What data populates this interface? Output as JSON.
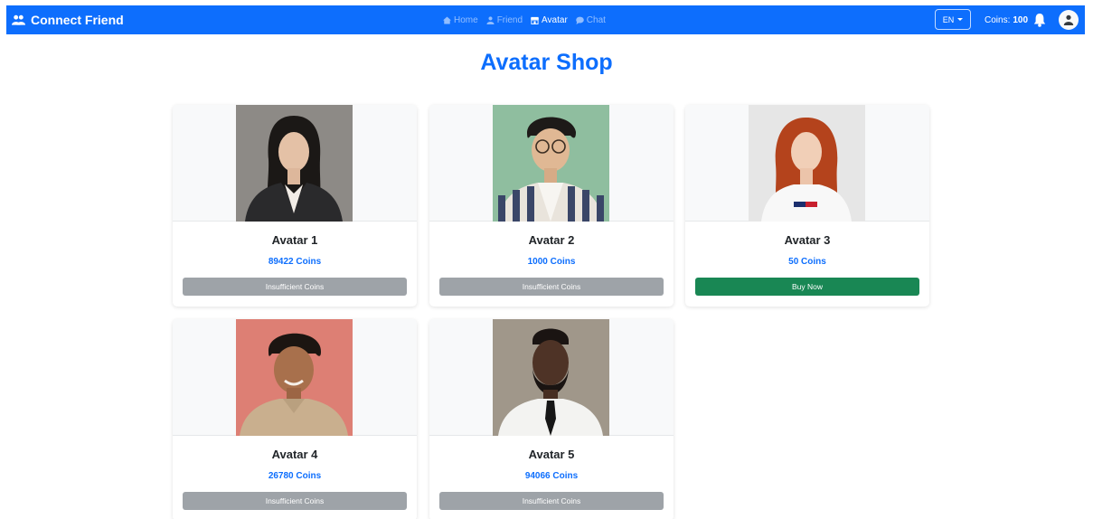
{
  "brand": {
    "name": "Connect Friend",
    "icon": "users-icon"
  },
  "nav": {
    "links": [
      {
        "label": "Home",
        "icon": "house-icon",
        "active": false
      },
      {
        "label": "Friend",
        "icon": "person-icon",
        "active": false
      },
      {
        "label": "Avatar",
        "icon": "shop-icon",
        "active": true
      },
      {
        "label": "Chat",
        "icon": "chat-icon",
        "active": false
      }
    ],
    "language": "EN",
    "coins_label": "Coins:",
    "coins_value": "100"
  },
  "page": {
    "title": "Avatar Shop"
  },
  "avatars": [
    {
      "name": "Avatar 1",
      "price": "89422 Coins",
      "button": "Insufficient Coins",
      "affordable": false
    },
    {
      "name": "Avatar 2",
      "price": "1000 Coins",
      "button": "Insufficient Coins",
      "affordable": false
    },
    {
      "name": "Avatar 3",
      "price": "50 Coins",
      "button": "Buy Now",
      "affordable": true
    },
    {
      "name": "Avatar 4",
      "price": "26780 Coins",
      "button": "Insufficient Coins",
      "affordable": false
    },
    {
      "name": "Avatar 5",
      "price": "94066 Coins",
      "button": "Insufficient Coins",
      "affordable": false
    }
  ],
  "colors": {
    "primary": "#0d6efd",
    "success": "#198754",
    "disabled": "#9ea3a8"
  }
}
